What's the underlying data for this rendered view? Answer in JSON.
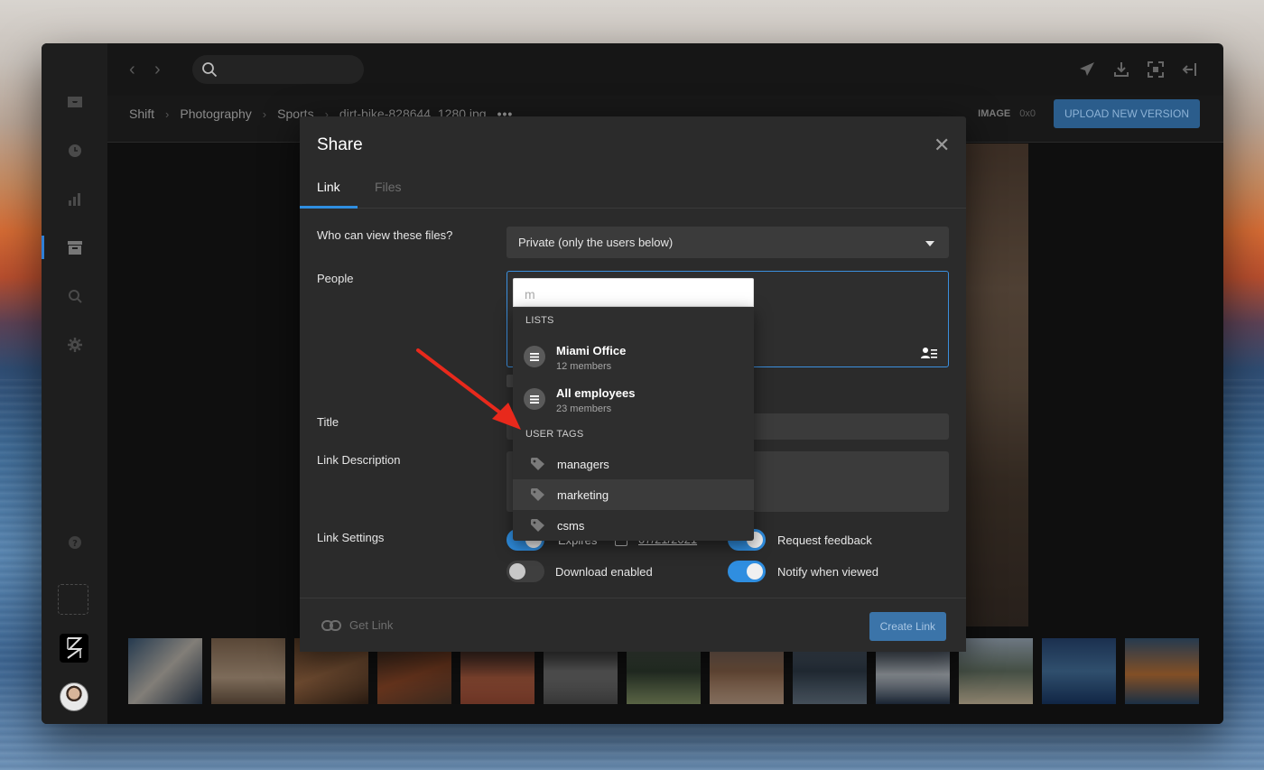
{
  "app": {
    "breadcrumbs": [
      "Shift",
      "Photography",
      "Sports",
      "dirt-bike-828644_1280.jpg"
    ],
    "more_glyph": "•••",
    "image_label": "IMAGE",
    "image_dims": "0x0",
    "upload_button": "UPLOAD NEW VERSION"
  },
  "modal": {
    "title": "Share",
    "tabs": [
      {
        "label": "Link",
        "active": true
      },
      {
        "label": "Files",
        "active": false
      }
    ],
    "who_label": "Who can view these files?",
    "who_value": "Private (only the users below)",
    "people_label": "People",
    "title_label": "Title",
    "description_label": "Link Description",
    "settings_label": "Link Settings",
    "settings": {
      "expires": {
        "label": "Expires",
        "on": true
      },
      "expires_date": "07/21/2021",
      "request_feedback": {
        "label": "Request feedback",
        "on": true
      },
      "download_enabled": {
        "label": "Download enabled",
        "on": false
      },
      "notify_viewed": {
        "label": "Notify when viewed",
        "on": true
      }
    },
    "get_link": "Get Link",
    "create_link": "Create Link"
  },
  "dropdown": {
    "query": "m",
    "lists_header": "LISTS",
    "lists": [
      {
        "name": "Miami Office",
        "meta": "12 members"
      },
      {
        "name": "All employees",
        "meta": "23 members"
      }
    ],
    "tags_header": "USER TAGS",
    "tags": [
      {
        "name": "managers",
        "hover": false
      },
      {
        "name": "marketing",
        "hover": true
      },
      {
        "name": "csms",
        "hover": false
      }
    ]
  },
  "colors": {
    "accent": "#2f8ee0",
    "annotation_arrow": "#e8291c"
  }
}
